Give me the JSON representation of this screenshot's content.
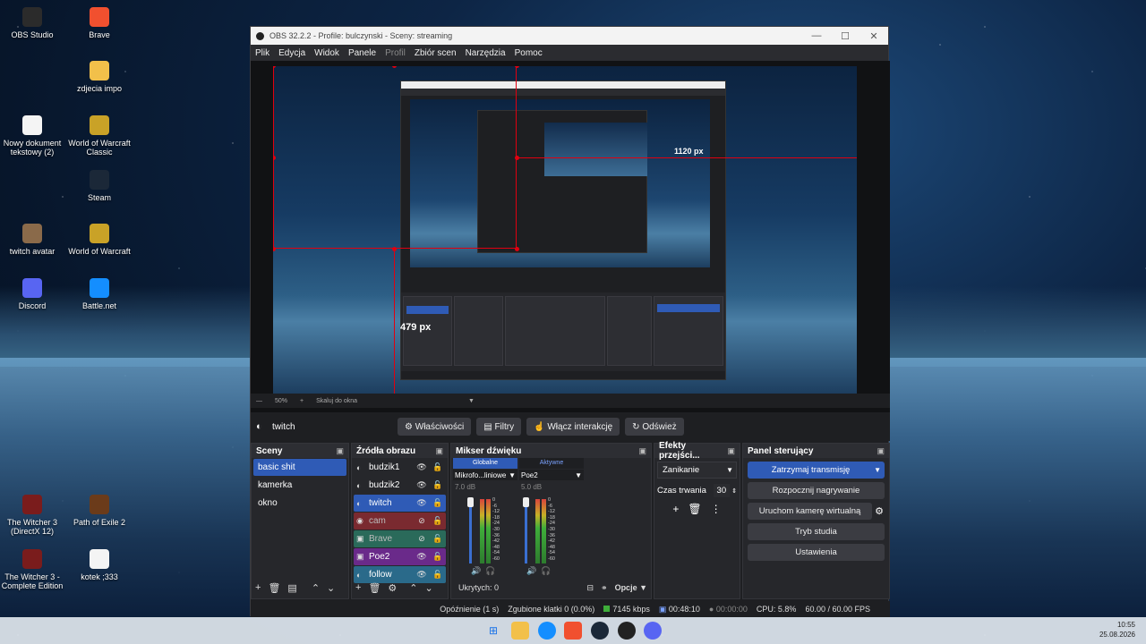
{
  "desktop": {
    "icons": [
      {
        "label": "OBS Studio",
        "icon": "obs-icon",
        "color": "#2b2b2b"
      },
      {
        "label": "Brave",
        "icon": "brave-icon",
        "color": "#f1502f"
      },
      {
        "label": "zdjecia impo",
        "icon": "folder-icon",
        "color": "#f2c04a"
      },
      {
        "label": "Nowy dokument tekstowy (2)",
        "icon": "text-file-icon",
        "color": "#f4f4f4"
      },
      {
        "label": "World of Warcraft Classic",
        "icon": "wow-classic-icon",
        "color": "#c9a227"
      },
      {
        "label": "Steam",
        "icon": "steam-icon",
        "color": "#1b2838"
      },
      {
        "label": "twitch avatar",
        "icon": "image-file-icon",
        "color": "#8a6a4a"
      },
      {
        "label": "World of Warcraft",
        "icon": "wow-icon",
        "color": "#c9a227"
      },
      {
        "label": "Discord",
        "icon": "discord-icon",
        "color": "#5865f2"
      },
      {
        "label": "Battle.net",
        "icon": "battlenet-icon",
        "color": "#148eff"
      },
      {
        "label": "The Witcher 3 (DirectX 12)",
        "icon": "witcher-icon",
        "color": "#7a1c1c"
      },
      {
        "label": "Path of Exile 2",
        "icon": "poe2-icon",
        "color": "#6b3b1a"
      },
      {
        "label": "The Witcher 3 - Complete Edition",
        "icon": "witcher-icon",
        "color": "#7a1c1c"
      },
      {
        "label": "kotek ;333",
        "icon": "text-file-icon",
        "color": "#f4f4f4"
      }
    ]
  },
  "window": {
    "title": "OBS 32.2.2 - Profile: bulczynski - Sceny: streaming",
    "controls": {
      "minimize": "—",
      "maximize": "☐",
      "close": "✕"
    }
  },
  "menu": [
    {
      "label": "Plik",
      "enabled": true
    },
    {
      "label": "Edycja",
      "enabled": true
    },
    {
      "label": "Widok",
      "enabled": true
    },
    {
      "label": "Panele",
      "enabled": true
    },
    {
      "label": "Profil",
      "enabled": false
    },
    {
      "label": "Zbiór scen",
      "enabled": true
    },
    {
      "label": "Narzędzia",
      "enabled": true
    },
    {
      "label": "Pomoc",
      "enabled": true
    }
  ],
  "preview": {
    "label_height": "479 px",
    "label_width": "1120 px",
    "zoom": "50%",
    "scale_label": "Skaluj do okna"
  },
  "source_bar": {
    "source_name": "twitch",
    "buttons": [
      "Właściwości",
      "Filtry",
      "Włącz interakcję",
      "Odśwież"
    ]
  },
  "scenes": {
    "title": "Sceny",
    "items": [
      "basic shit",
      "kamerka",
      "okno"
    ],
    "selected": 0
  },
  "sources": {
    "title": "Źródła obrazu",
    "items": [
      {
        "label": "budzik1",
        "type": "globe",
        "visible": true,
        "bg": ""
      },
      {
        "label": "budzik2",
        "type": "globe",
        "visible": true,
        "bg": ""
      },
      {
        "label": "twitch",
        "type": "globe",
        "visible": true,
        "bg": "#2f5bb6"
      },
      {
        "label": "cam",
        "type": "camera",
        "visible": false,
        "bg": "#7a2a30"
      },
      {
        "label": "Brave",
        "type": "window",
        "visible": false,
        "bg": "#2a6a5a"
      },
      {
        "label": "Poe2",
        "type": "window",
        "visible": true,
        "bg": "#6a2a8a"
      },
      {
        "label": "follow",
        "type": "globe",
        "visible": true,
        "bg": "#2a6a8a"
      }
    ]
  },
  "mixer": {
    "title": "Mikser dźwięku",
    "tabs": [
      "Globalne",
      "Aktywne"
    ],
    "channels": [
      {
        "name": "Mikrofo...liniowe",
        "db": "7.0 dB"
      },
      {
        "name": "Poe2",
        "db": "5.0 dB"
      }
    ],
    "scale": [
      "0",
      "-6",
      "-12",
      "-18",
      "-24",
      "-30",
      "-36",
      "-42",
      "-48",
      "-54",
      "-60"
    ],
    "hidden_label": "Ukrytych: 0",
    "options_label": "Opcje"
  },
  "transitions": {
    "title": "Efekty przejści...",
    "type": "Zanikanie",
    "duration_label": "Czas trwania",
    "duration_value": "30"
  },
  "controls": {
    "title": "Panel sterujący",
    "buttons": [
      "Zatrzymaj transmisję",
      "Rozpocznij nagrywanie",
      "Uruchom kamerę wirtualną",
      "Tryb studia",
      "Ustawienia"
    ]
  },
  "status": {
    "delay": "Opóźnienie (1 s)",
    "dropped": "Zgubione klatki 0 (0.0%)",
    "bitrate": "7145 kbps",
    "stream_time": "00:48:10",
    "rec_time": "00:00:00",
    "cpu": "CPU: 5.8%",
    "fps": "60.00 / 60.00 FPS"
  },
  "taskbar": {
    "time": "10:55",
    "date": "25.08.2026"
  },
  "colors": {
    "accent": "#2f5bb6",
    "stream_red": "#e00010"
  }
}
